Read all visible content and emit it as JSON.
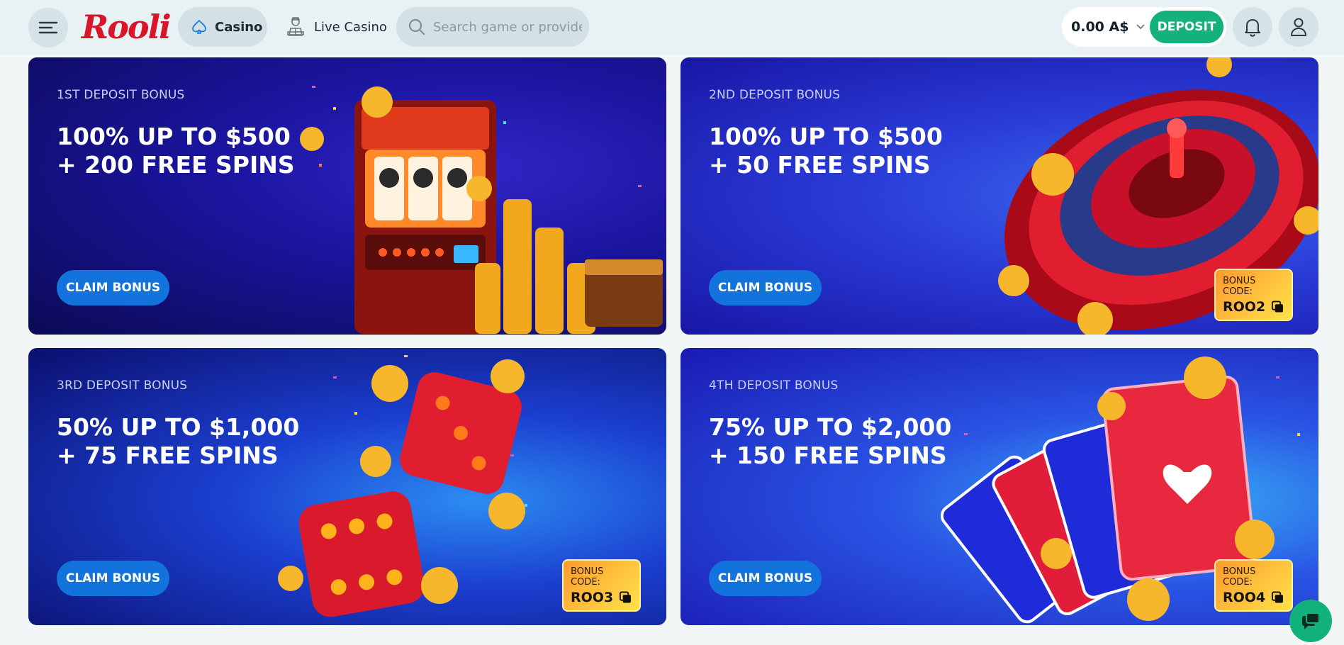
{
  "header": {
    "logo_text": "Rooli",
    "nav": [
      {
        "label": "Casino",
        "active": true,
        "icon": "spade-icon"
      },
      {
        "label": "Live Casino",
        "active": false,
        "icon": "dealer-icon"
      }
    ],
    "search": {
      "placeholder": "Search game or provider"
    },
    "balance": "0.00 A$",
    "deposit_label": "DEPOSIT"
  },
  "cards": [
    {
      "subtitle": "1ST DEPOSIT BONUS",
      "title_line1": "100% UP TO $500",
      "title_line2": "+ 200 FREE SPINS",
      "button": "CLAIM BONUS",
      "art": "slot-machine"
    },
    {
      "subtitle": "2ND DEPOSIT BONUS",
      "title_line1": "100% UP TO $500",
      "title_line2": "+ 50 FREE SPINS",
      "button": "CLAIM BONUS",
      "art": "roulette",
      "code_label": "BONUS CODE:",
      "code": "ROO2"
    },
    {
      "subtitle": "3RD DEPOSIT BONUS",
      "title_line1": "50% UP TO $1,000",
      "title_line2": "+ 75 FREE SPINS",
      "button": "CLAIM BONUS",
      "art": "dice",
      "code_label": "BONUS CODE:",
      "code": "ROO3"
    },
    {
      "subtitle": "4TH DEPOSIT BONUS",
      "title_line1": "75% UP TO $2,000",
      "title_line2": "+ 150 FREE SPINS",
      "button": "CLAIM BONUS",
      "art": "playing-cards",
      "code_label": "BONUS CODE:",
      "code": "ROO4"
    }
  ],
  "colors": {
    "brand_red": "#d8152a",
    "deposit_green": "#14b27a",
    "claim_blue": "#1273dd"
  }
}
